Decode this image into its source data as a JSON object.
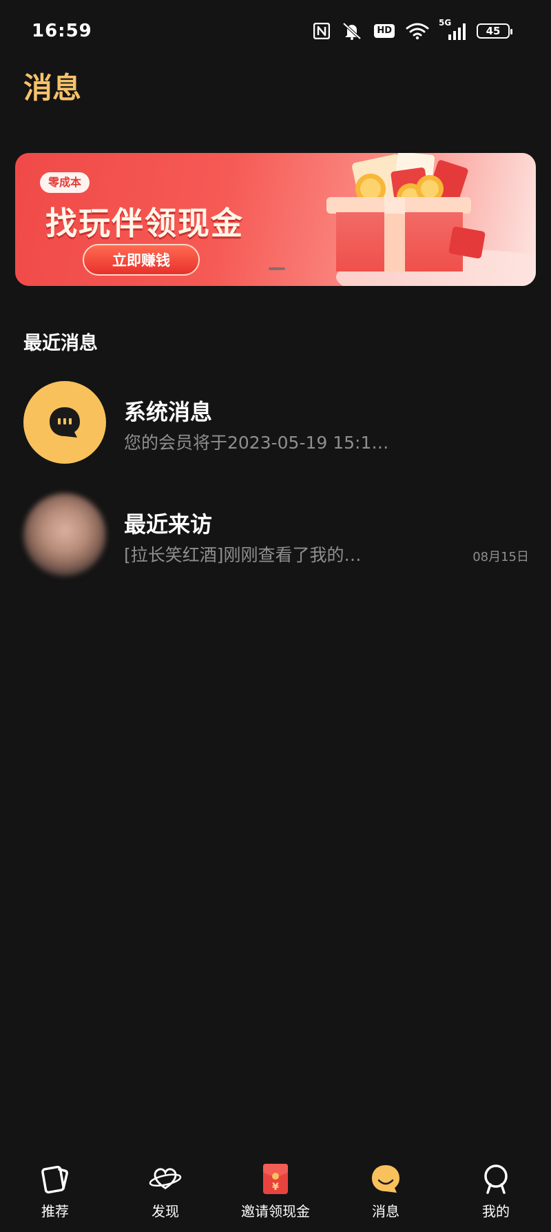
{
  "status_bar": {
    "time": "16:59",
    "icons": [
      "nfc-icon",
      "mute-icon",
      "hd-icon",
      "wifi-icon",
      "signal-5g-icon"
    ],
    "network": "5G",
    "hd": "HD",
    "battery": "45"
  },
  "page": {
    "title": "消息"
  },
  "banner": {
    "badge": "零成本",
    "title": "找玩伴领现金",
    "button": "立即赚钱"
  },
  "section": {
    "title": "最近消息"
  },
  "messages": [
    {
      "name": "系统消息",
      "preview": "您的会员将于2023-05-19 15:1…",
      "time": "",
      "avatar": "chat-bubble-icon"
    },
    {
      "name": "最近来访",
      "preview": "[拉长笑红酒]刚刚查看了我的…",
      "time": "08月15日",
      "avatar": "user-photo"
    }
  ],
  "bottom_nav": [
    {
      "label": "推荐",
      "icon": "cards-icon",
      "active": false
    },
    {
      "label": "发现",
      "icon": "planet-icon",
      "active": false
    },
    {
      "label": "邀请领现金",
      "icon": "red-envelope-icon",
      "active": false
    },
    {
      "label": "消息",
      "icon": "message-icon",
      "active": true
    },
    {
      "label": "我的",
      "icon": "profile-icon",
      "active": false
    }
  ],
  "colors": {
    "background": "#141414",
    "accent": "#f6c26a",
    "secondary_text": "#8f8f8f",
    "banner_red": "#f04a48"
  }
}
